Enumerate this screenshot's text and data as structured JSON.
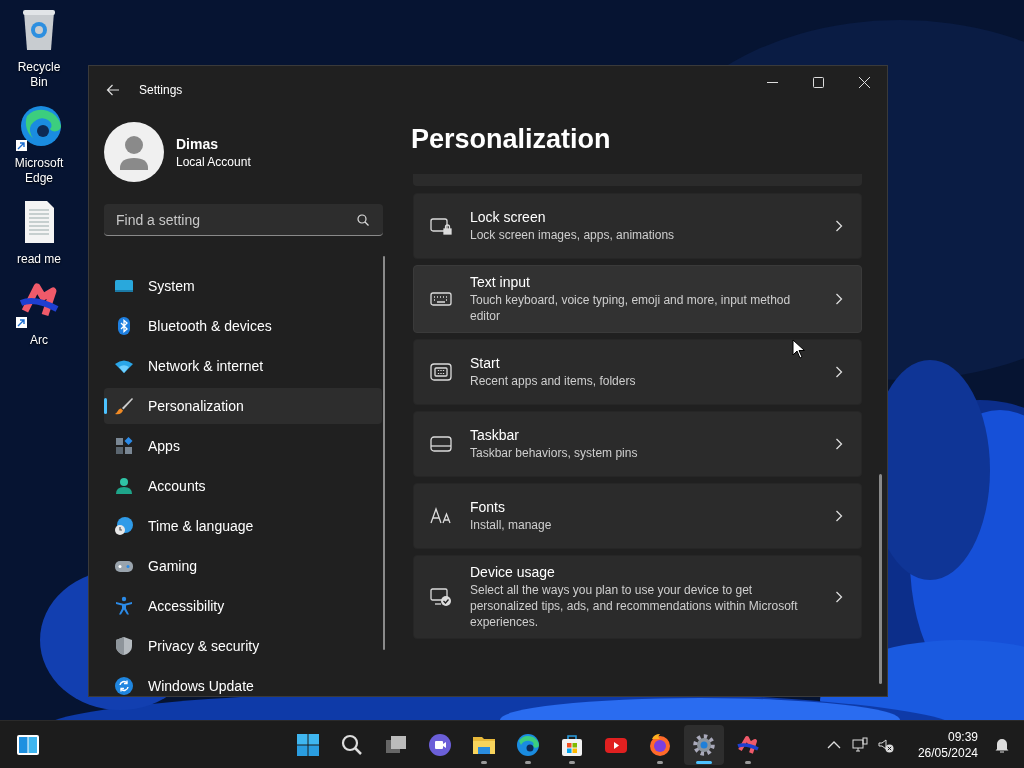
{
  "desktop_icons": [
    {
      "label": "Recycle Bin",
      "kind": "recycle",
      "shortcut": false
    },
    {
      "label": "Microsoft Edge",
      "kind": "edge",
      "shortcut": true
    },
    {
      "label": "read me",
      "kind": "document",
      "shortcut": false
    },
    {
      "label": "Arc",
      "kind": "arc",
      "shortcut": true
    }
  ],
  "window": {
    "title": "Settings",
    "user": {
      "name": "Dimas",
      "account": "Local Account"
    },
    "search": {
      "placeholder": "Find a setting"
    },
    "nav": [
      {
        "label": "System",
        "kind": "system",
        "selected": false
      },
      {
        "label": "Bluetooth & devices",
        "kind": "bluetooth",
        "selected": false
      },
      {
        "label": "Network & internet",
        "kind": "network",
        "selected": false
      },
      {
        "label": "Personalization",
        "kind": "brush",
        "selected": true
      },
      {
        "label": "Apps",
        "kind": "apps",
        "selected": false
      },
      {
        "label": "Accounts",
        "kind": "accounts",
        "selected": false
      },
      {
        "label": "Time & language",
        "kind": "time",
        "selected": false
      },
      {
        "label": "Gaming",
        "kind": "gaming",
        "selected": false
      },
      {
        "label": "Accessibility",
        "kind": "accessibility",
        "selected": false
      },
      {
        "label": "Privacy & security",
        "kind": "shield",
        "selected": false
      },
      {
        "label": "Windows Update",
        "kind": "update",
        "selected": false
      }
    ],
    "page_title": "Personalization",
    "cards": [
      {
        "title": "Lock screen",
        "description": "Lock screen images, apps, animations",
        "kind": "lock",
        "hovered": false
      },
      {
        "title": "Text input",
        "description": "Touch keyboard, voice typing, emoji and more, input method editor",
        "kind": "keyboard",
        "hovered": true
      },
      {
        "title": "Start",
        "description": "Recent apps and items, folders",
        "kind": "start",
        "hovered": false
      },
      {
        "title": "Taskbar",
        "description": "Taskbar behaviors, system pins",
        "kind": "taskbar",
        "hovered": false
      },
      {
        "title": "Fonts",
        "description": "Install, manage",
        "kind": "fonts",
        "hovered": false
      },
      {
        "title": "Device usage",
        "description": "Select all the ways you plan to use your device to get personalized tips, ads, and recommendations within Microsoft experiences.",
        "kind": "device",
        "hovered": false
      }
    ]
  },
  "taskbar": {
    "apps": [
      {
        "kind": "start",
        "running": false,
        "selected": false
      },
      {
        "kind": "search",
        "running": false,
        "selected": false
      },
      {
        "kind": "taskview",
        "running": false,
        "selected": false
      },
      {
        "kind": "meet",
        "running": false,
        "selected": false
      },
      {
        "kind": "explorer",
        "running": true,
        "selected": false
      },
      {
        "kind": "edge",
        "running": true,
        "selected": false
      },
      {
        "kind": "store",
        "running": true,
        "selected": false
      },
      {
        "kind": "video",
        "running": false,
        "selected": false
      },
      {
        "kind": "firefox",
        "running": true,
        "selected": false
      },
      {
        "kind": "settings",
        "running": true,
        "selected": true
      },
      {
        "kind": "arc",
        "running": true,
        "selected": false
      }
    ],
    "time": "09:39",
    "date": "26/05/2024"
  }
}
